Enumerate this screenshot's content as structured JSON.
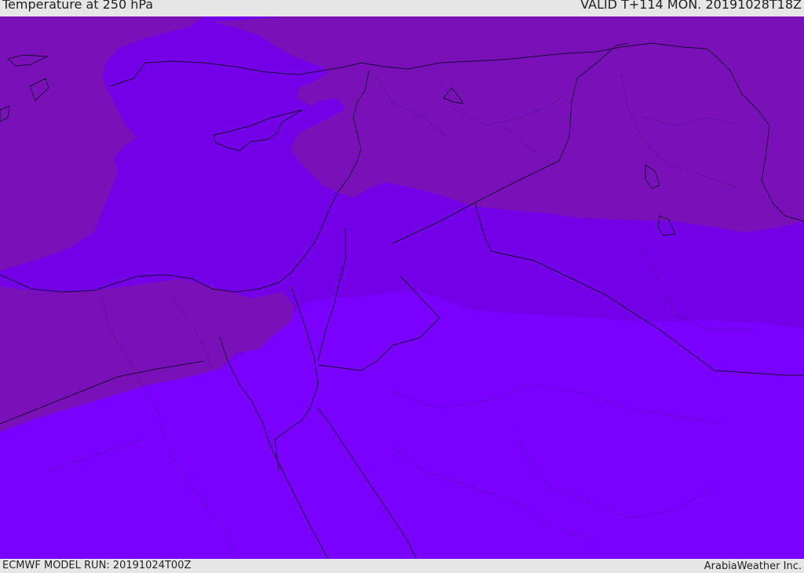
{
  "header": {
    "title": "Temperature at 250 hPa",
    "valid": "VALID T+114 MON. 20191028T18Z"
  },
  "footer": {
    "model_run": "ECMWF MODEL RUN: 20191024T00Z",
    "brand": "ArabiaWeather Inc."
  },
  "colors": {
    "warm_band": "#7a00ff",
    "mid_band": "#7300e6",
    "cool_band": "#7a10b8",
    "coastline": "#1a0a3a",
    "background": "#e6e6e6"
  }
}
